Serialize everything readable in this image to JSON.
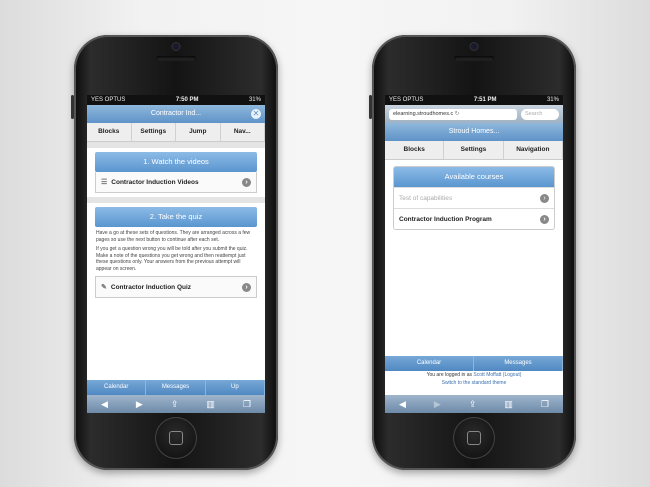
{
  "left_phone": {
    "status": {
      "carrier": "YES OPTUS",
      "time": "7:50 PM",
      "battery": "31%"
    },
    "title": "Contractor Ind...",
    "close_icon": "close-icon",
    "tabs": [
      "Blocks",
      "Settings",
      "Jump",
      "Nav..."
    ],
    "section1": {
      "header": "1. Watch the videos",
      "item": "Contractor Induction Videos"
    },
    "section2": {
      "header": "2. Take the quiz",
      "para1": "Have a go at these sets of questions. They are arranged across a few pages so use the next button to continue after each set.",
      "para2": "If you get a question wrong you will be told after you submit the quiz. Make a note of the questions you get wrong and then reattempt just these questions only. Your answers from the previous attempt will appear on screen.",
      "item": "Contractor Induction Quiz"
    },
    "bottom_nav": [
      "Calendar",
      "Messages",
      "Up"
    ],
    "toolbar_icons": [
      "back-icon",
      "forward-icon",
      "share-icon",
      "bookmarks-icon",
      "tabs-icon"
    ]
  },
  "right_phone": {
    "status": {
      "carrier": "YES OPTUS",
      "time": "7:51 PM",
      "battery": "31%"
    },
    "url": "elearning.stroudhomes.c",
    "search_placeholder": "Search",
    "title": "Stroud Homes...",
    "tabs": [
      "Blocks",
      "Settings",
      "Navigation"
    ],
    "courses": {
      "header": "Available courses",
      "items": [
        "Test of capabilities",
        "Contractor Induction Program"
      ]
    },
    "bottom_nav": [
      "Calendar",
      "Messages"
    ],
    "logged_in": "You are logged in as",
    "user": "Scott Moffatt",
    "logout": "(Logout)",
    "theme_link": "Switch to the standard theme"
  }
}
